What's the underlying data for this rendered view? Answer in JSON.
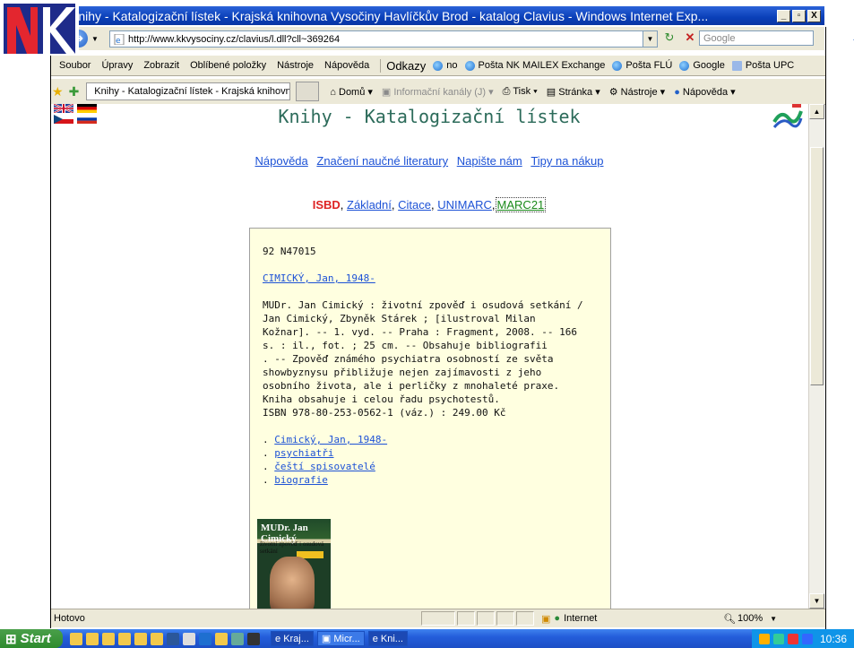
{
  "window": {
    "title": "Knihy - Katalogizační lístek - Krajská knihovna Vysočiny Havlíčkův Brod - katalog Clavius - Windows Internet Exp...",
    "min": "_",
    "max": "▫",
    "close": "X"
  },
  "address": {
    "url": "http://www.kkvysociny.cz/clavius/l.dll?cll~369264",
    "search_placeholder": "Google"
  },
  "menu": [
    "Soubor",
    "Úpravy",
    "Zobrazit",
    "Oblíbené položky",
    "Nástroje",
    "Nápověda"
  ],
  "links_label": "Odkazy",
  "links": [
    "no",
    "Pošta NK MAILEX Exchange",
    "Pošta FLÚ",
    "Google",
    "Pošta UPC"
  ],
  "tab": {
    "label": "Knihy - Katalogizační lístek - Krajská knihovn..."
  },
  "commands": {
    "home": "Domů",
    "feeds": "Informační kanály (J)",
    "print": "Tisk",
    "page": "Stránka",
    "tools": "Nástroje",
    "help": "Nápověda"
  },
  "page": {
    "heading": "Knihy - Katalogizační lístek",
    "toplinks": [
      "Nápověda",
      "Značení naučné literatury",
      "Napište nám",
      "Tipy na nákup"
    ],
    "formats": {
      "isbd": "ISBD",
      "basic": "Základní",
      "citation": "Citace",
      "unimarc": "UNIMARC",
      "marc21": "MARC21",
      "sep": ","
    },
    "card": {
      "id": "92 N47015",
      "author_link": "CIMICKÝ, Jan, 1948-",
      "description": [
        "MUDr. Jan Cimický : životní zpověď i osudová setkání /",
        "Jan Cimický, Zbyněk Stárek ; [ilustroval Milan",
        "Kožnar]. -- 1. vyd. -- Praha : Fragment, 2008. -- 166",
        "s. : il., fot. ; 25 cm. -- Obsahuje bibliografii",
        ". -- Zpověď známého psychiatra osobností ze světa",
        "showbyznysu přibližuje nejen zajímavosti z jeho",
        "osobního života, ale i perličky z mnohaleté praxe.",
        "Kniha obsahuje i celou řadu psychotestů.",
        "ISBN 978-80-253-0562-1 (váz.) : 249.00 Kč"
      ],
      "subject_links": [
        "Cimický, Jan, 1948-",
        "psychiatři",
        "čeští spisovatelé",
        "biografie"
      ],
      "bullet": ".",
      "cover_title": "MUDr. Jan Cimický",
      "cover_subtitle": "životní zpověď i osudová setkání"
    }
  },
  "status": {
    "text": "Hotovo",
    "zone": "Internet",
    "zoom": "100%"
  },
  "taskbar": {
    "start": "Start",
    "items": [
      "Kraj...",
      "Micr...",
      "Kni..."
    ],
    "clock": "10:36"
  }
}
